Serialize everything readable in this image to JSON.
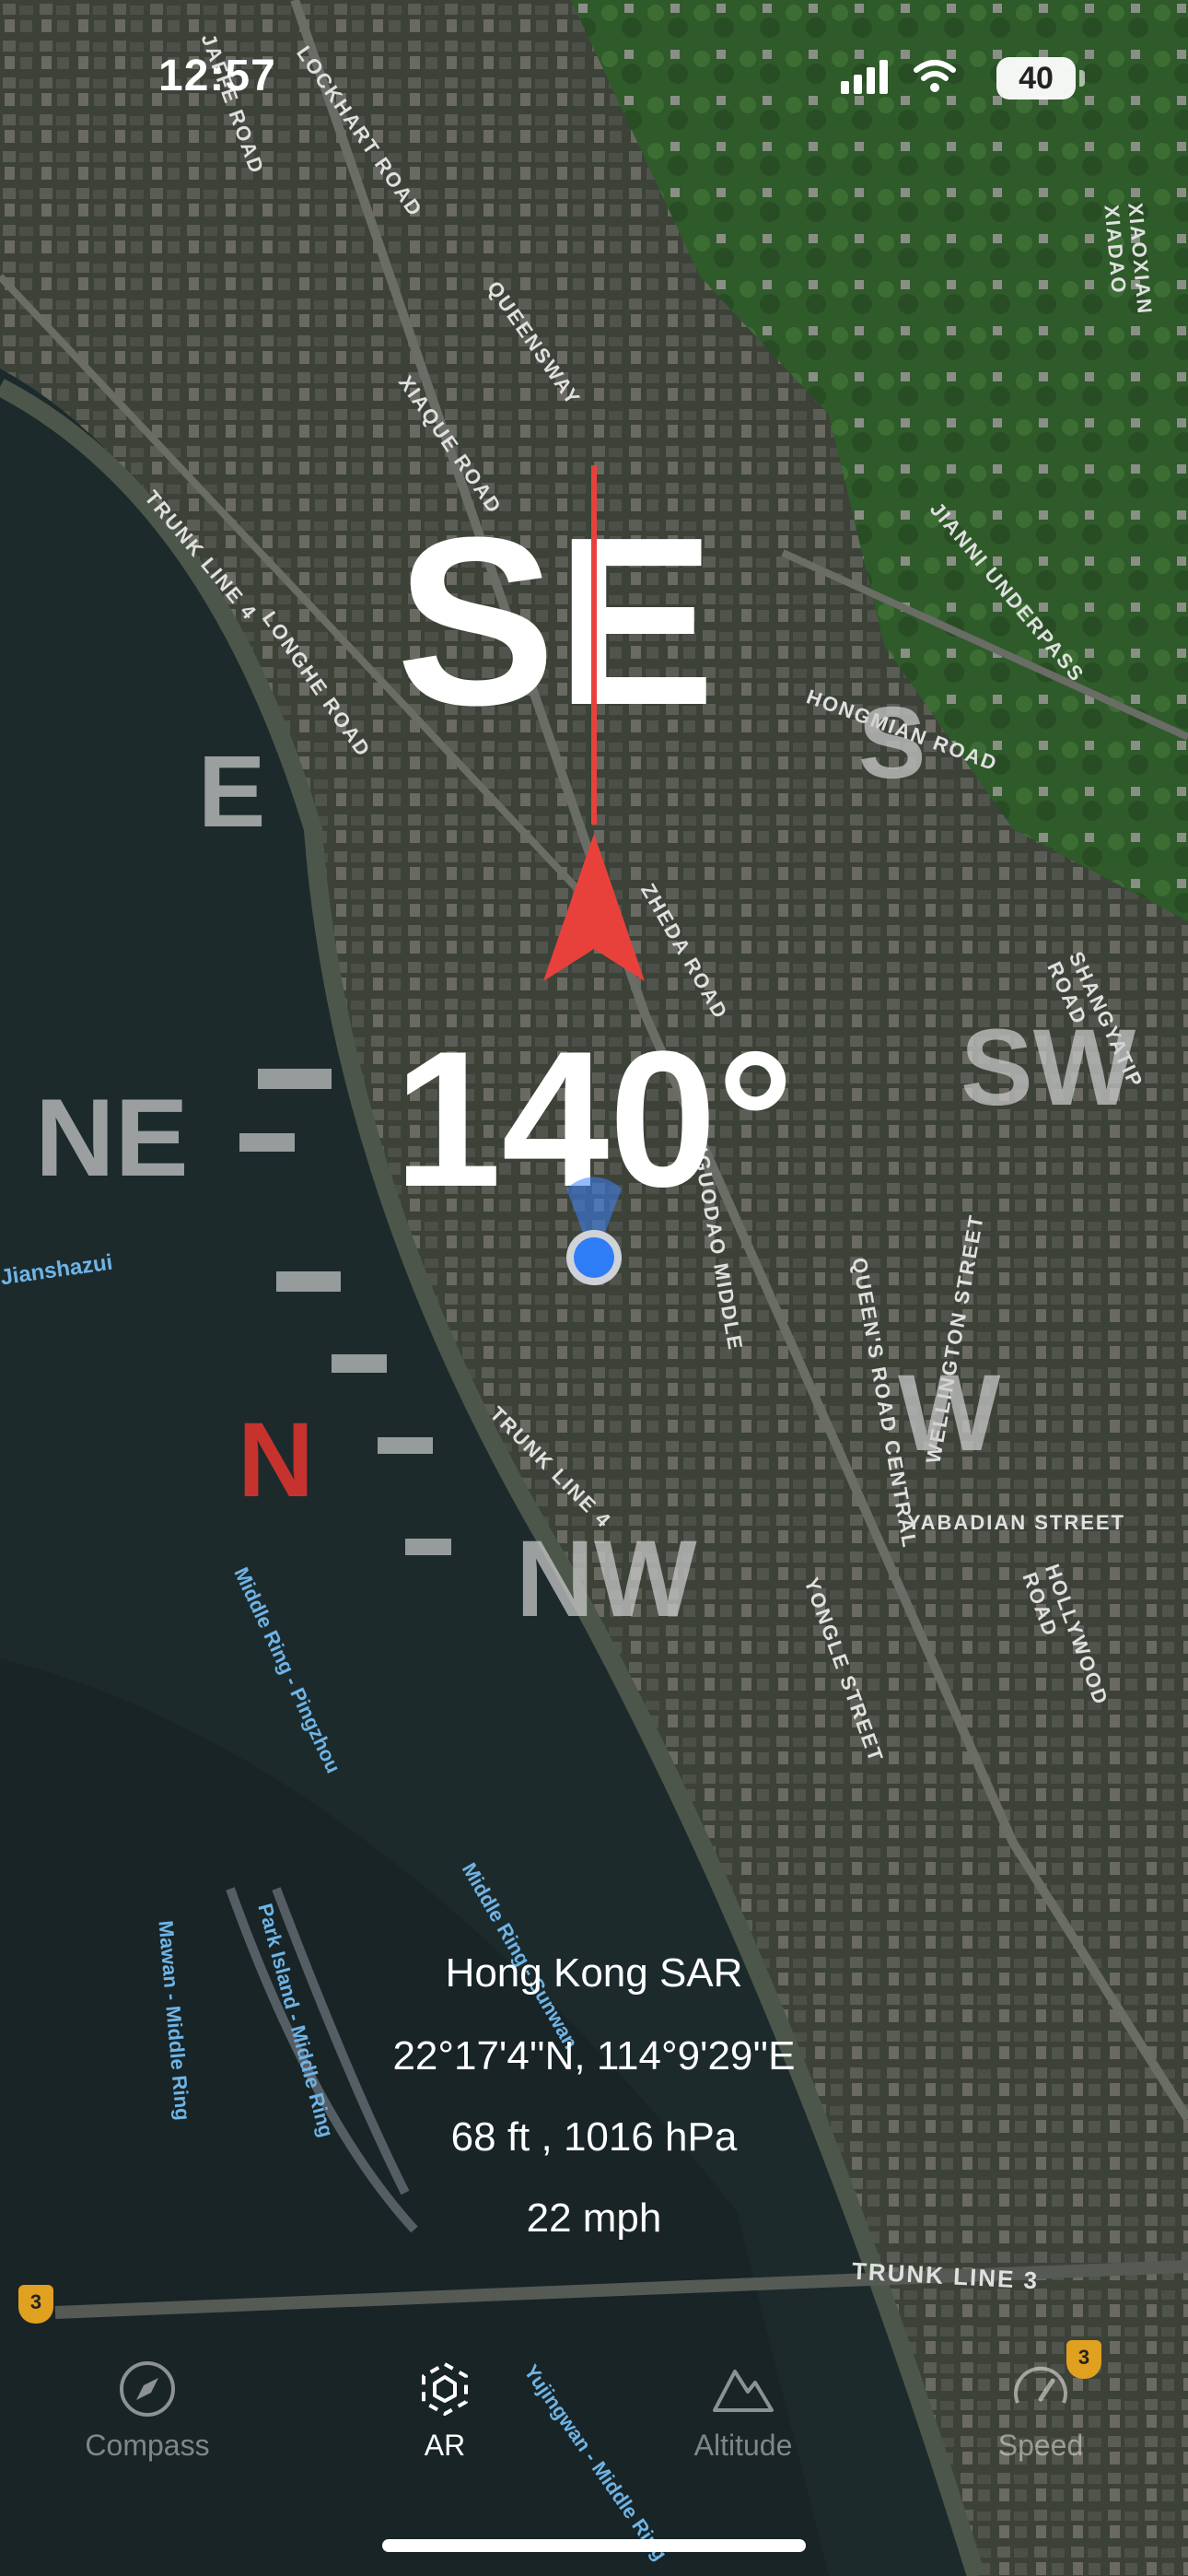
{
  "status_bar": {
    "time": "12:57",
    "battery": "40"
  },
  "map_labels": [
    "JAFFE ROAD",
    "LOCKHART ROAD",
    "QUEENSWAY",
    "XIAQUE ROAD",
    "LONGHE ROAD",
    "TRUNK LINE 4",
    "HONGMIAN ROAD",
    "JIANNI UNDERPASS",
    "SHANGYATIP ROAD",
    "ZHEDA ROAD",
    "GANGUODAO MIDDLE",
    "QUEEN'S ROAD CENTRAL",
    "WELLINGTON STREET",
    "YABADIAN STREET",
    "HOLLYWOOD ROAD",
    "TRUNK LINE 4",
    "YONGLE STREET",
    "Jianshazui",
    "Middle Ring - Pingzhou",
    "Mawan - Middle Ring",
    "Park Island - Middle Ring",
    "Middle Ring - Sunwan",
    "Yujingwan - Middle Ring",
    "TRUNK LINE 3",
    "XIAOXIAN XIADAO",
    "3",
    "3"
  ],
  "compass": {
    "heading_dir": "SE",
    "directions": {
      "e": "E",
      "s": "S",
      "ne": "NE",
      "sw": "SW",
      "n": "N",
      "w": "W",
      "nw": "NW"
    },
    "heading": "140°",
    "accent": "#e8413c"
  },
  "location": {
    "place": "Hong Kong SAR",
    "coords": "22°17'4''N, 114°9'29''E",
    "altitude_pressure": "68 ft , 1016 hPa",
    "speed": "22 mph"
  },
  "tabs": [
    {
      "label": "Compass",
      "icon": "compass-icon",
      "active": false
    },
    {
      "label": "AR",
      "icon": "ar-icon",
      "active": true
    },
    {
      "label": "Altitude",
      "icon": "mountain-icon",
      "active": false
    },
    {
      "label": "Speed",
      "icon": "speedometer-icon",
      "active": false
    }
  ]
}
